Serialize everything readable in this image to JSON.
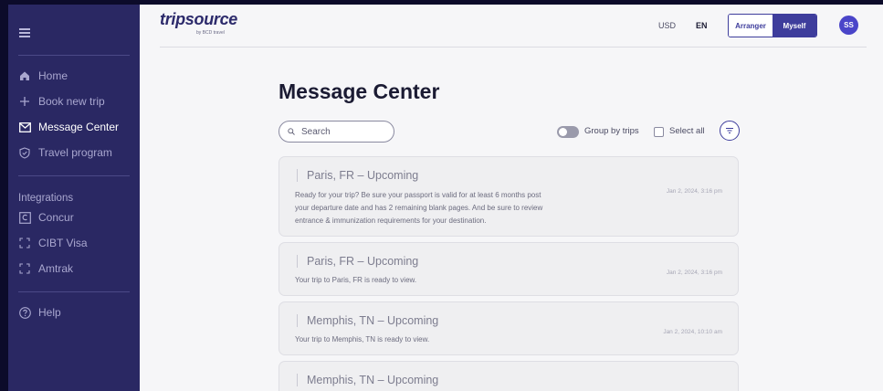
{
  "sidebar": {
    "items": [
      {
        "label": "Home",
        "icon": "home-icon"
      },
      {
        "label": "Book new trip",
        "icon": "plus-icon"
      },
      {
        "label": "Message Center",
        "icon": "mail-icon"
      },
      {
        "label": "Travel program",
        "icon": "shield-icon"
      }
    ],
    "integrations_heading": "Integrations",
    "integrations": [
      {
        "label": "Concur",
        "icon": "concur-icon"
      },
      {
        "label": "CIBT Visa",
        "icon": "bracket-icon"
      },
      {
        "label": "Amtrak",
        "icon": "bracket-icon"
      }
    ],
    "help": {
      "label": "Help",
      "icon": "help-icon"
    }
  },
  "header": {
    "logo_text": "tripsource",
    "logo_sub": "by BCD travel",
    "currency": "USD",
    "language": "EN",
    "arranger_label": "Arranger",
    "myself_label": "Myself",
    "avatar_initials": "SS"
  },
  "main": {
    "title": "Message Center",
    "search_placeholder": "Search",
    "group_by_label": "Group by trips",
    "select_all_label": "Select all"
  },
  "messages": [
    {
      "title": "Paris, FR – Upcoming",
      "body": [
        "Ready for your trip? Be sure your passport is valid for at least 6 months post",
        "your departure date and has 2 remaining blank pages. And be sure to review",
        "entrance & immunization requirements for your destination."
      ],
      "date": "Jan 2, 2024, 3:16 pm"
    },
    {
      "title": "Paris, FR – Upcoming",
      "body": [
        "Your trip to Paris, FR is ready to view."
      ],
      "date": "Jan 2, 2024, 3:16 pm"
    },
    {
      "title": "Memphis, TN – Upcoming",
      "body": [
        "Your trip to Memphis, TN is ready to view."
      ],
      "date": "Jan 2, 2024, 10:10 am"
    },
    {
      "title": "Memphis, TN – Upcoming",
      "body": [],
      "date": ""
    }
  ],
  "colors": {
    "sidebar_bg": "#2a2863",
    "accent": "#3e3d9c",
    "avatar_bg": "#4a45c9"
  }
}
